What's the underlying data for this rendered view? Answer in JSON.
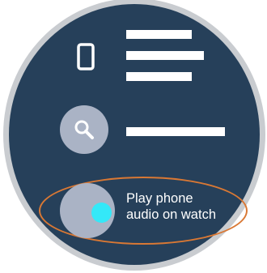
{
  "watch": {
    "screen_color": "#26405a",
    "bezel_color": "#c9ccd0"
  },
  "items": [
    {
      "icon": "phone-icon",
      "has_label": false
    },
    {
      "icon": "search-icon",
      "has_label": false
    },
    {
      "icon": "toggle-dot-icon",
      "label_line_1": "Play phone",
      "label_line_2": "audio on watch",
      "highlighted": true
    }
  ],
  "colors": {
    "icon_circle": "#aab3c5",
    "toggle_dot": "#34e8f8",
    "highlight_ring": "#d97834",
    "text": "#ffffff"
  }
}
